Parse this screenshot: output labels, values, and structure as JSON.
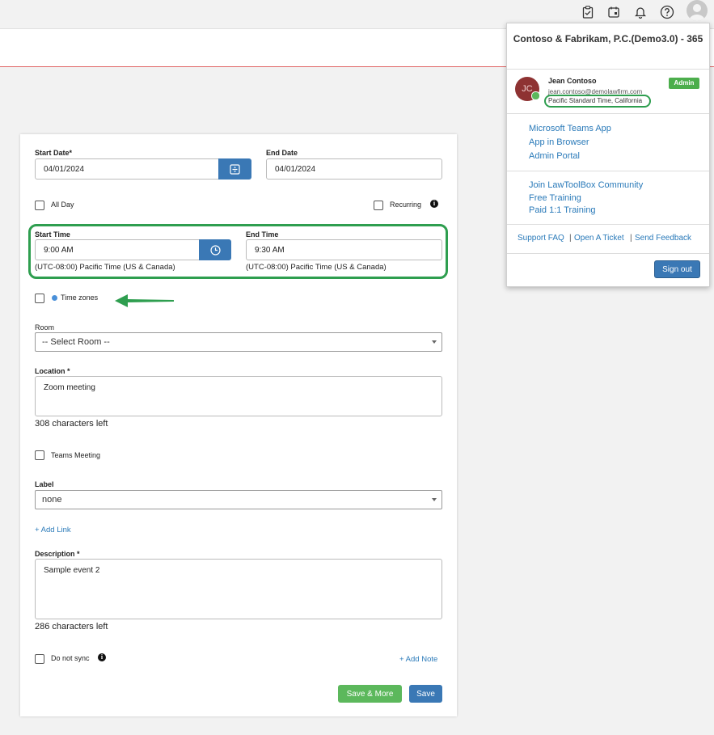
{
  "form": {
    "start_date_label": "Start Date*",
    "start_date_value": "04/01/2024",
    "end_date_label": "End Date",
    "end_date_value": "04/01/2024",
    "all_day_label": "All Day",
    "recurring_label": "Recurring",
    "start_time_label": "Start Time",
    "start_time_value": "9:00 AM",
    "start_tz": "(UTC-08:00) Pacific Time (US & Canada)",
    "end_time_label": "End Time",
    "end_time_value": "9:30 AM",
    "end_tz": "(UTC-08:00) Pacific Time (US & Canada)",
    "time_zones_label": "Time zones",
    "room_label": "Room",
    "room_value": "-- Select Room --",
    "location_label": "Location *",
    "location_value": "Zoom meeting",
    "location_count": "308 characters left",
    "teams_label": "Teams Meeting",
    "label_label": "Label",
    "label_value": "none",
    "add_link": "+ Add Link",
    "description_label": "Description *",
    "description_value": "Sample event 2",
    "description_count": "286 characters left",
    "do_not_sync_label": "Do not sync",
    "add_note": "+ Add Note",
    "save_more_label": "Save & More",
    "save_label": "Save"
  },
  "popup": {
    "title": "Contoso & Fabrikam, P.C.(Demo3.0) - 365",
    "avatar_initials": "JC",
    "user_name": "Jean Contoso",
    "user_email": "jean.contoso@demolawfirm.com",
    "user_tz": "Pacific Standard Time, California",
    "role_badge": "Admin",
    "apps": [
      "Microsoft Teams App",
      "App in Browser",
      "Admin Portal"
    ],
    "community": [
      "Join LawToolBox Community",
      "Free Training",
      "Paid 1:1 Training"
    ],
    "footer_links": [
      "Support FAQ",
      "Open A Ticket",
      "Send Feedback"
    ],
    "separator": "|",
    "sign_out": "Sign out"
  },
  "topbar_icons": [
    "clipboard-check-icon",
    "calendar-icon",
    "bell-icon",
    "help-icon",
    "user-avatar-icon"
  ],
  "colors": {
    "primary": "#3a78b5",
    "success": "#5cb85c",
    "highlight": "#2e9e4f",
    "link": "#2a7ab9",
    "avatar": "#8e3232"
  }
}
